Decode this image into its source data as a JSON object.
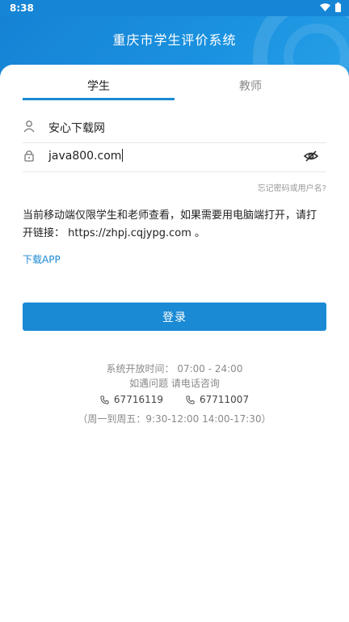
{
  "status_bar": {
    "time": "8:38"
  },
  "header": {
    "title": "重庆市学生评价系统"
  },
  "tabs": [
    {
      "label": "学生",
      "active": true
    },
    {
      "label": "教师",
      "active": false
    }
  ],
  "form": {
    "username_value": "安心下载网",
    "password_value": "java800.com",
    "forgot_link": "忘记密码或用户名?"
  },
  "notice": {
    "text": "当前移动端仅限学生和老师查看，如果需要用电脑端打开，请打开链接：  https://zhpj.cqjypg.com 。"
  },
  "download_link": "下载APP",
  "login_button": "登录",
  "contact": {
    "open_time": "系统开放时间： 07:00 - 24:00",
    "consult": "如遇问题 请电话咨询",
    "phone_1": "67716119",
    "phone_2": "67711007",
    "hours": "（周一到周五：9:30-12:00 14:00-17:30）"
  },
  "colors": {
    "primary": "#1a8ad4",
    "header": "#1685d6"
  },
  "icons": [
    "user-icon",
    "lock-icon",
    "eye-off-icon",
    "phone-icon",
    "wifi-icon",
    "battery-icon"
  ]
}
